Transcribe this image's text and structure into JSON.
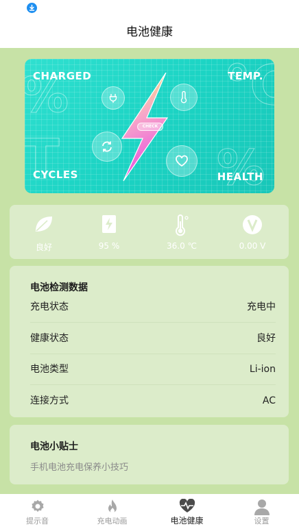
{
  "header": {
    "title": "电池健康"
  },
  "status_bar": {
    "download_icon": "download-icon"
  },
  "hero": {
    "corners": {
      "top_left": "CHARGED",
      "top_right": "TEMP.",
      "bottom_left": "CYCLES",
      "bottom_right": "HEALTH"
    },
    "check_label": "CHECK",
    "colors": {
      "background": "#1fd6c6",
      "bolt_top": "#f9f36a",
      "bolt_bottom": "#e94fe0"
    }
  },
  "stats": [
    {
      "icon": "leaf-icon",
      "value": "良好"
    },
    {
      "icon": "battery-charge-icon",
      "value": "95 %"
    },
    {
      "icon": "thermometer-icon",
      "value": "36.0 ℃"
    },
    {
      "icon": "voltage-icon",
      "value": "0.00 V"
    }
  ],
  "battery_data": {
    "title": "电池检测数据",
    "rows": [
      {
        "label": "充电状态",
        "value": "充电中"
      },
      {
        "label": "健康状态",
        "value": "良好"
      },
      {
        "label": "电池类型",
        "value": "Li-ion"
      },
      {
        "label": "连接方式",
        "value": "AC"
      }
    ]
  },
  "tips": {
    "title": "电池小贴士",
    "subtitle": "手机电池充电保养小技巧"
  },
  "tabbar": {
    "active_index": 2,
    "tabs": [
      {
        "icon": "gear-icon",
        "label": "提示音"
      },
      {
        "icon": "flame-icon",
        "label": "充电动画"
      },
      {
        "icon": "heart-pulse-icon",
        "label": "电池健康"
      },
      {
        "icon": "user-icon",
        "label": "设置"
      }
    ]
  },
  "colors": {
    "page_bg": "#c7e2a6",
    "card_bg": "#dcecca",
    "tab_active": "#222222",
    "tab_inactive": "#9a9a9a"
  }
}
